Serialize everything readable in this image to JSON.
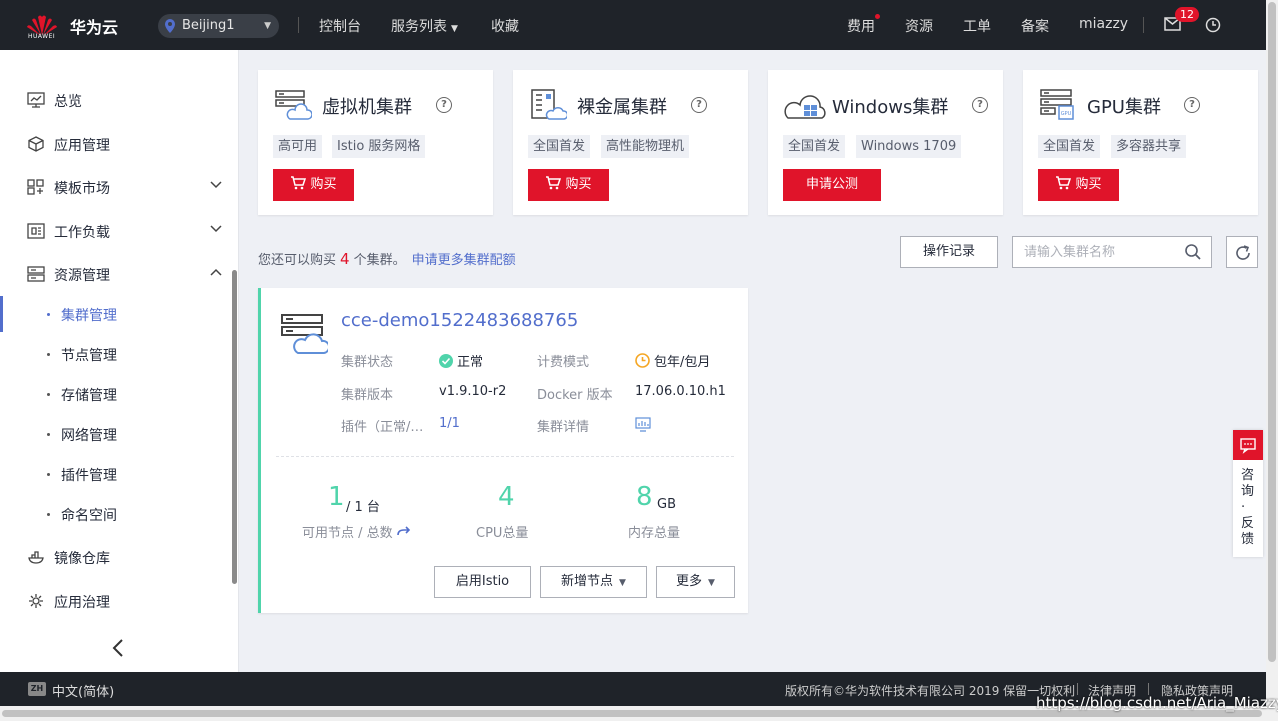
{
  "topbar": {
    "logo_text": "HUAWEI",
    "brand": "华为云",
    "region": "Beijing1",
    "nav": [
      "控制台",
      "服务列表",
      "收藏"
    ],
    "right_nav": [
      "费用",
      "资源",
      "工单",
      "备案",
      "miazzy"
    ],
    "mail_badge": "12",
    "icons": [
      "location-pin-icon",
      "mail-icon",
      "clock-icon"
    ]
  },
  "sidebar": {
    "items": [
      {
        "label": "总览",
        "icon": "monitor-icon"
      },
      {
        "label": "应用管理",
        "icon": "cube-icon"
      },
      {
        "label": "模板市场",
        "icon": "grid-icon",
        "expandable": true
      },
      {
        "label": "工作负载",
        "icon": "workload-icon",
        "expandable": true
      },
      {
        "label": "资源管理",
        "icon": "server-icon",
        "expanded": true
      }
    ],
    "subitems": [
      "集群管理",
      "节点管理",
      "存储管理",
      "网络管理",
      "插件管理",
      "命名空间"
    ],
    "active_subitem": "集群管理",
    "bottom_items": [
      {
        "label": "镜像仓库",
        "icon": "image-repo-icon"
      },
      {
        "label": "应用治理",
        "icon": "governance-icon"
      }
    ]
  },
  "cards": [
    {
      "title": "虚拟机集群",
      "tags": [
        "高可用",
        "Istio 服务网格"
      ],
      "button": "购买"
    },
    {
      "title": "裸金属集群",
      "tags": [
        "全国首发",
        "高性能物理机"
      ],
      "button": "购买"
    },
    {
      "title": "Windows集群",
      "tags": [
        "全国首发",
        "Windows 1709"
      ],
      "button": "申请公测"
    },
    {
      "title": "GPU集群",
      "tags": [
        "全国首发",
        "多容器共享"
      ],
      "button": "购买"
    }
  ],
  "toolbar": {
    "quota_prefix": "您还可以购买",
    "quota_num": "4",
    "quota_suffix": "个集群。",
    "quota_link": "申请更多集群配额",
    "op_record": "操作记录",
    "search_placeholder": "请输入集群名称"
  },
  "cluster": {
    "name": "cce-demo1522483688765",
    "status_label": "集群状态",
    "status_value": "正常",
    "billing_label": "计费模式",
    "billing_value": "包年/包月",
    "version_label": "集群版本",
    "version_value": "v1.9.10-r2",
    "docker_label": "Docker 版本",
    "docker_value": "17.06.0.10.h1",
    "plugin_label": "插件（正常/…",
    "plugin_value": "1/1",
    "detail_label": "集群详情",
    "nodes_available": "1",
    "nodes_total": "/ 1 台",
    "nodes_label": "可用节点 / 总数",
    "cpu_value": "4",
    "cpu_label": "CPU总量",
    "mem_value": "8",
    "mem_unit": "GB",
    "mem_label": "内存总量",
    "buttons": [
      "启用Istio",
      "新增节点",
      "更多"
    ]
  },
  "feedback": {
    "text": "咨询·反馈"
  },
  "footer": {
    "lang": "中文(简体)",
    "lang_badge": "ZH",
    "copyright": "版权所有©华为软件技术有限公司 2019 保留一切权利",
    "links": [
      "法律声明",
      "隐私政策声明"
    ]
  },
  "watermark": "https://blog.csdn.net/Aria_Miazzy",
  "colors": {
    "accent_red": "#e0142a",
    "link_blue": "#526ecc",
    "success_green": "#50d4ab",
    "warning_orange": "#f5a623"
  }
}
